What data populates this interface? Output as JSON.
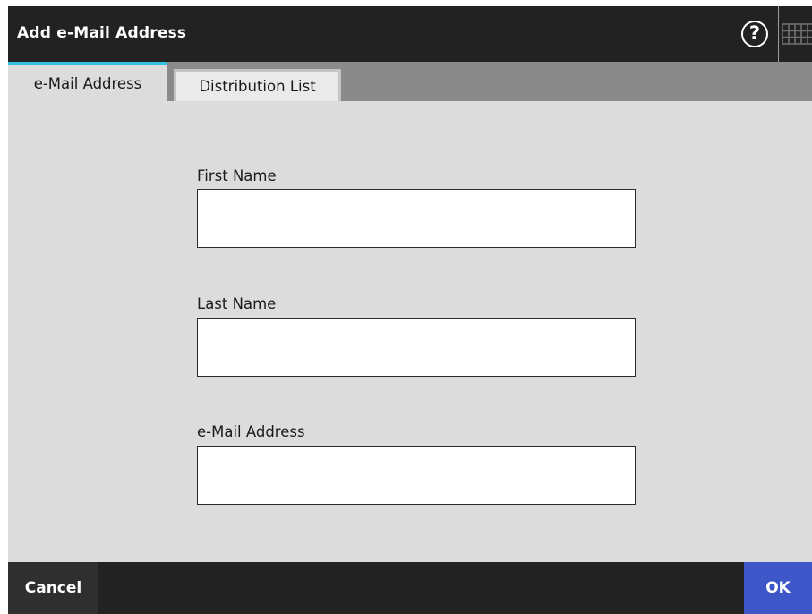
{
  "window": {
    "title": "Add e-Mail Address",
    "help_glyph": "?",
    "help_icon": "help-icon",
    "keyboard_icon": "keyboard-icon"
  },
  "tabs": [
    {
      "label": "e-Mail Address",
      "active": true
    },
    {
      "label": "Distribution List",
      "active": false
    }
  ],
  "form": {
    "first_name": {
      "label": "First Name",
      "value": "",
      "placeholder": ""
    },
    "last_name": {
      "label": "Last Name",
      "value": "",
      "placeholder": ""
    },
    "email": {
      "label": "e-Mail Address",
      "value": "",
      "placeholder": ""
    }
  },
  "footer": {
    "cancel_label": "Cancel",
    "ok_label": "OK"
  },
  "colors": {
    "titlebar": "#222222",
    "tab_accent": "#35c1e0",
    "ok_button": "#3e57c8",
    "content_bg": "#dcdcdc"
  }
}
